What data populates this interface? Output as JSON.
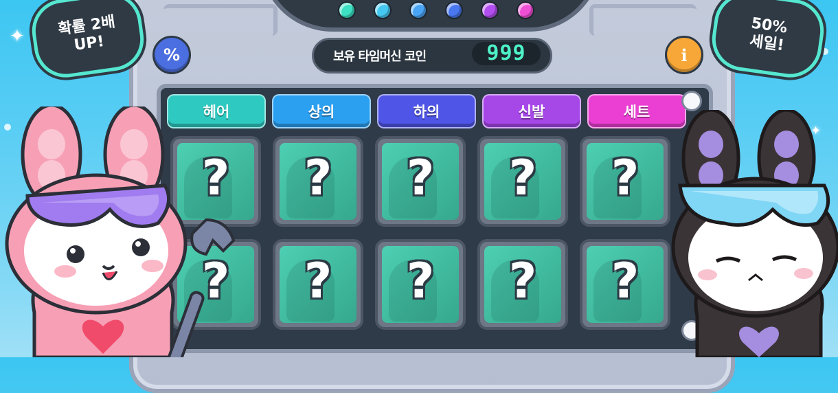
{
  "lights": [
    "#3de0c3",
    "#45c9f0",
    "#4aa4f5",
    "#4877ef",
    "#b24ef0",
    "#ef4fd5"
  ],
  "coins": {
    "label": "보유 타임머신 코인",
    "value": "999"
  },
  "buttons": {
    "percent": "%",
    "info": "i"
  },
  "tabs": [
    {
      "label": "헤어",
      "color": "#2ec9c0"
    },
    {
      "label": "상의",
      "color": "#2b9ff0"
    },
    {
      "label": "하의",
      "color": "#4f55e6"
    },
    {
      "label": "신발",
      "color": "#a647e8"
    },
    {
      "label": "세트",
      "color": "#ea3fd2"
    }
  ],
  "cards": [
    {
      "symbol": "?"
    },
    {
      "symbol": "?"
    },
    {
      "symbol": "?"
    },
    {
      "symbol": "?"
    },
    {
      "symbol": "?"
    },
    {
      "symbol": "?"
    },
    {
      "symbol": "?"
    },
    {
      "symbol": "?"
    },
    {
      "symbol": "?"
    },
    {
      "symbol": "?"
    }
  ],
  "badges": {
    "left": [
      "확률 2배",
      "UP!"
    ],
    "right": [
      "50%",
      "세일!"
    ]
  }
}
